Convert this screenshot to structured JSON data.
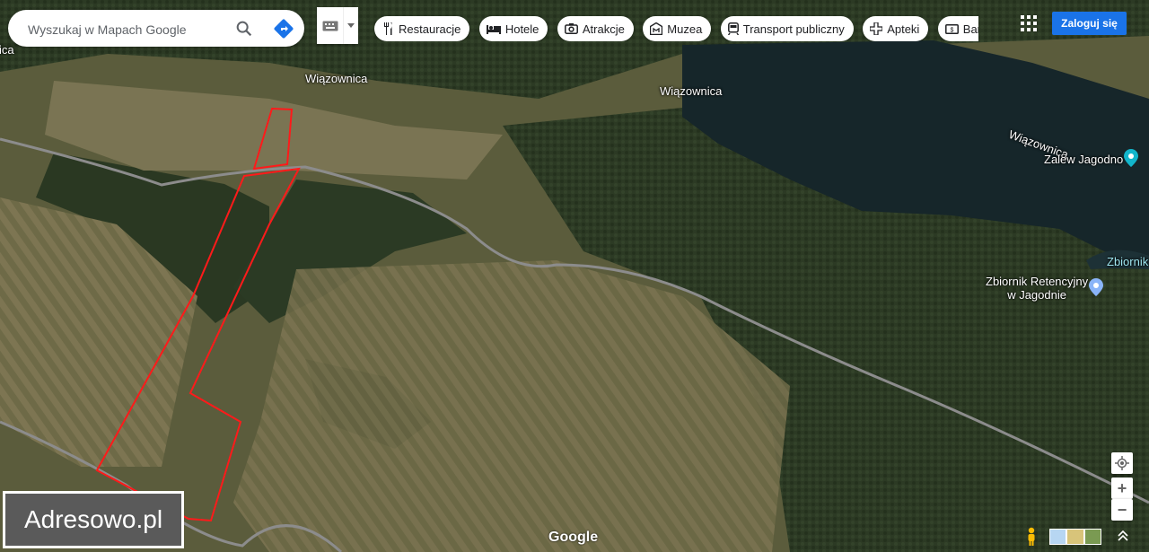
{
  "search": {
    "placeholder": "Wyszukaj w Mapach Google"
  },
  "icons": {
    "search": "search-icon",
    "directions": "directions-icon",
    "keyboard": "keyboard-icon",
    "apps": "apps-grid-icon",
    "location": "my-location-icon",
    "pegman": "pegman-icon"
  },
  "chips": [
    {
      "label": "Restauracje",
      "icon": "fork-knife-icon"
    },
    {
      "label": "Hotele",
      "icon": "bed-icon"
    },
    {
      "label": "Atrakcje",
      "icon": "camera-icon"
    },
    {
      "label": "Muzea",
      "icon": "museum-icon"
    },
    {
      "label": "Transport publiczny",
      "icon": "train-icon"
    },
    {
      "label": "Apteki",
      "icon": "pharmacy-icon"
    },
    {
      "label": "Bankomat",
      "icon": "atm-icon"
    }
  ],
  "header": {
    "login_label": "Zaloguj się"
  },
  "map_labels": {
    "road_1": "Wiązownica",
    "road_2": "Wiązownica",
    "road_3": "Wiązownica",
    "lake": "Zalew Jagodno",
    "reservoir_line1": "Zbiornik Retencyjny",
    "reservoir_line2": "w Jagodnie",
    "reservoir_short": "Zbiornik",
    "partial": "ica"
  },
  "watermark": "Adresowo.pl",
  "provider": "Google",
  "zoom": {
    "in": "+",
    "out": "−"
  },
  "colors": {
    "plot_outline": "#ff1a1a",
    "accent": "#1a73e8",
    "lake": "#16262a"
  }
}
